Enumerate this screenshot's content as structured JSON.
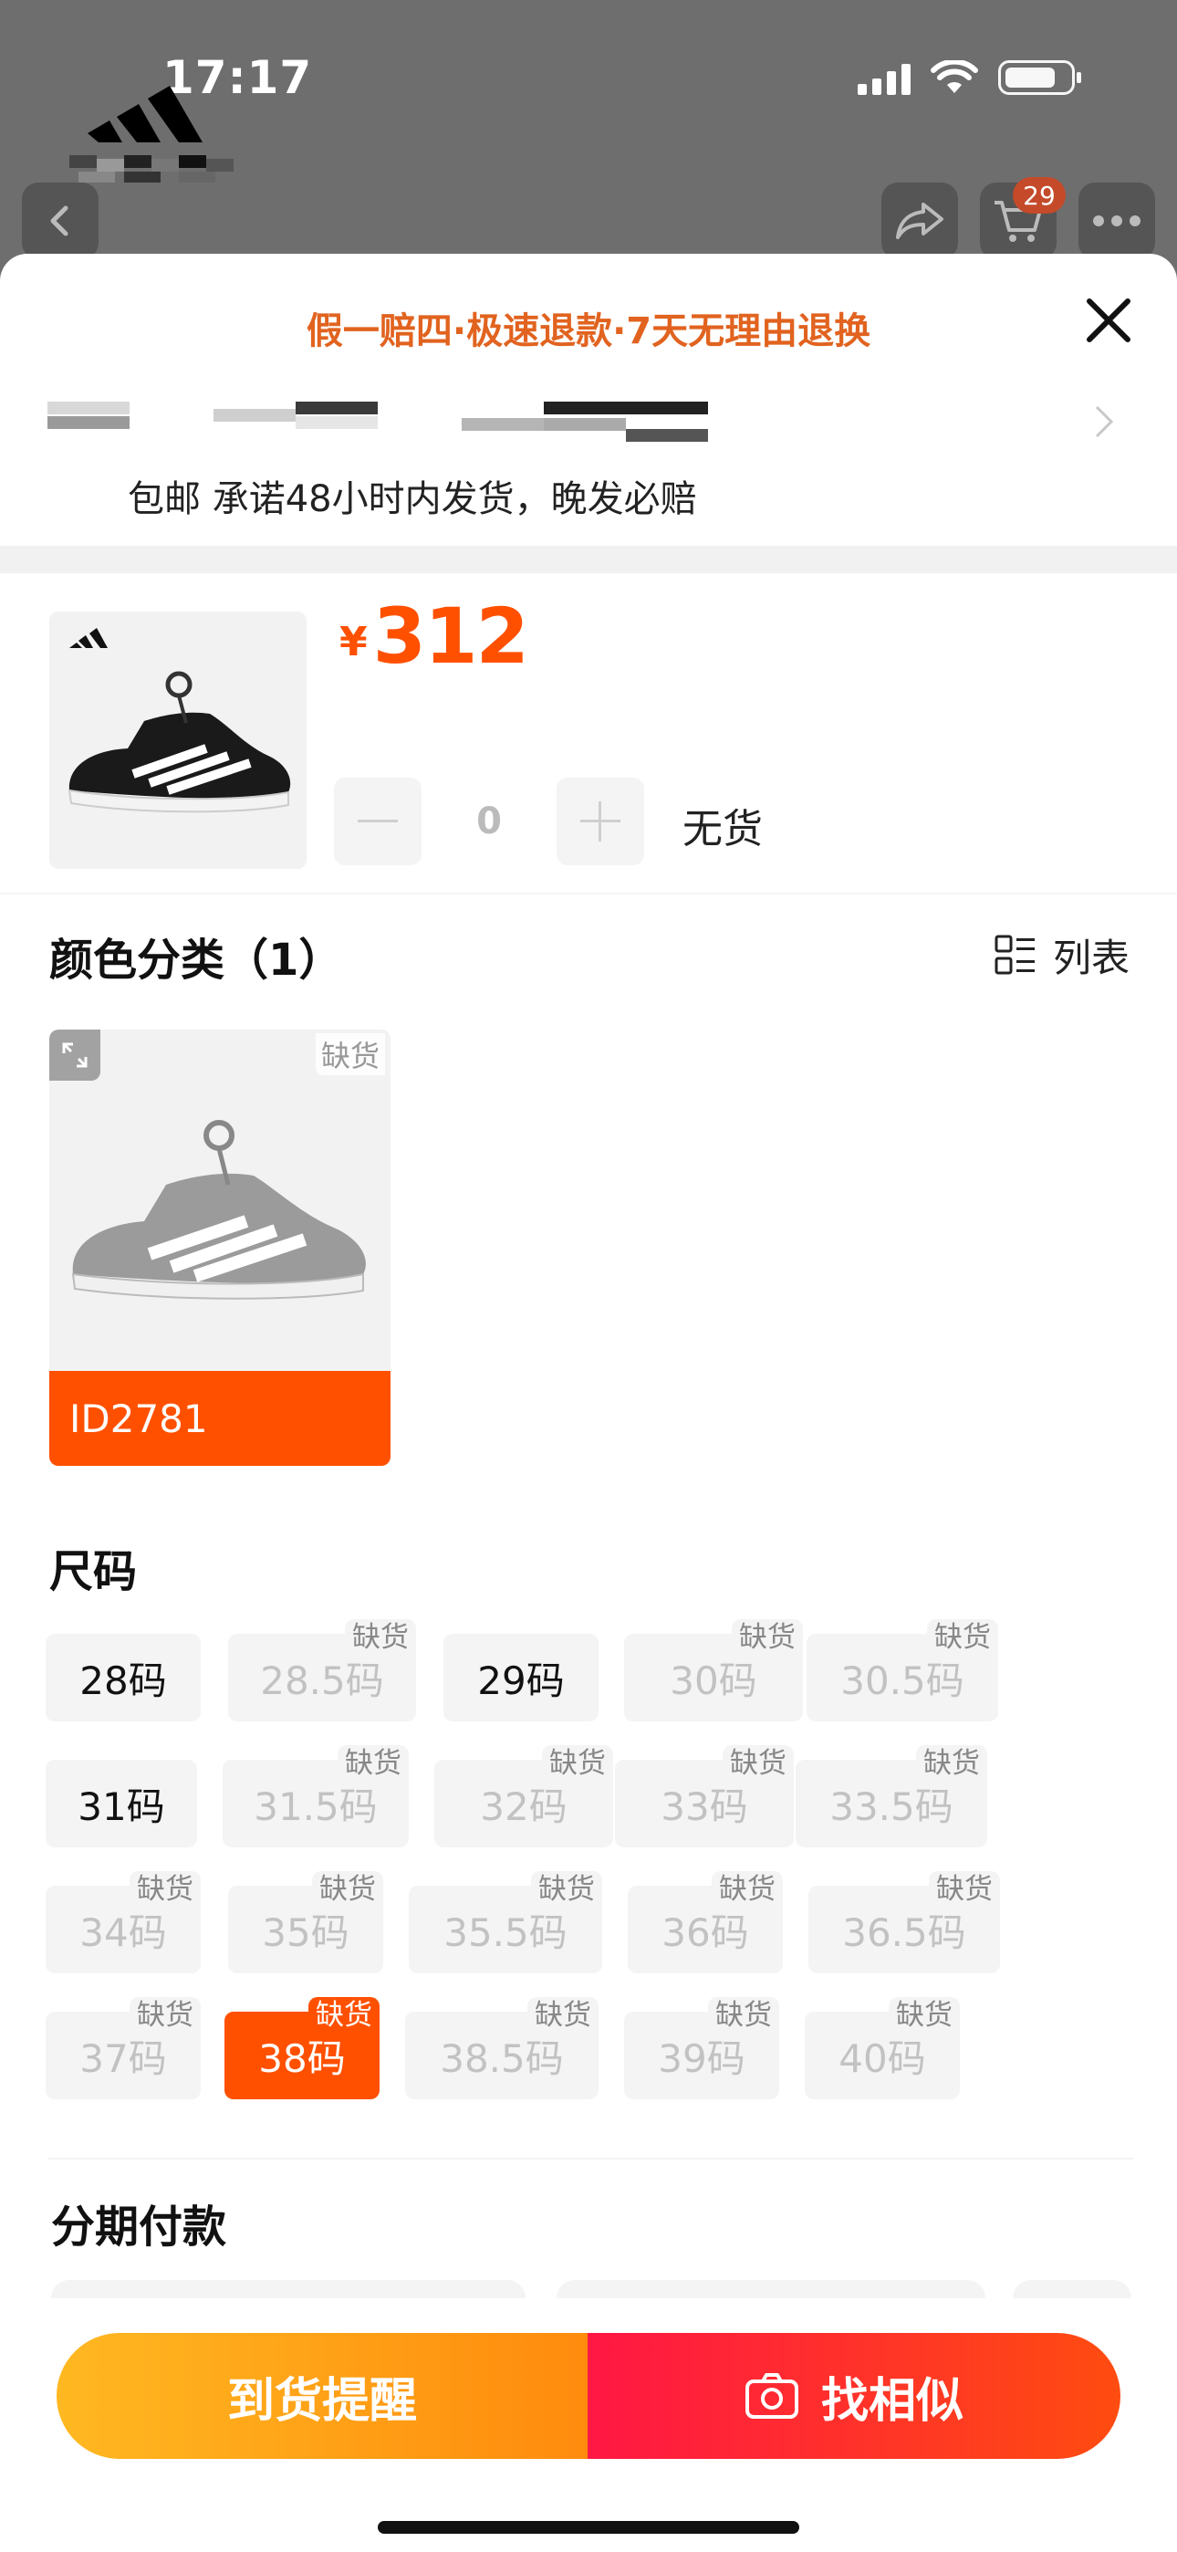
{
  "status_bar": {
    "time": "17:17"
  },
  "header": {
    "cart_badge": "29"
  },
  "sheet": {
    "guarantee_text": "假一赔四·极速退款·7天无理由退换",
    "shipping_text": "包邮 承诺48小时内发货，晚发必赔"
  },
  "product": {
    "currency": "¥",
    "price": "312",
    "quantity": "0",
    "stock_status": "无货"
  },
  "color_section": {
    "title": "颜色分类（1）",
    "list_toggle_label": "列表",
    "options": [
      {
        "label": "ID2781",
        "tag": "缺货",
        "selected": true
      }
    ]
  },
  "size_section": {
    "title": "尺码",
    "out_of_stock_tag": "缺货",
    "rows": [
      [
        {
          "label": "28码",
          "oos": false
        },
        {
          "label": "28.5码",
          "oos": true
        },
        {
          "label": "29码",
          "oos": false
        },
        {
          "label": "30码",
          "oos": true
        },
        {
          "label": "30.5码",
          "oos": true
        }
      ],
      [
        {
          "label": "31码",
          "oos": false
        },
        {
          "label": "31.5码",
          "oos": true
        },
        {
          "label": "32码",
          "oos": true
        },
        {
          "label": "33码",
          "oos": true
        },
        {
          "label": "33.5码",
          "oos": true
        }
      ],
      [
        {
          "label": "34码",
          "oos": true
        },
        {
          "label": "35码",
          "oos": true
        },
        {
          "label": "35.5码",
          "oos": true
        },
        {
          "label": "36码",
          "oos": true
        },
        {
          "label": "36.5码",
          "oos": true
        }
      ],
      [
        {
          "label": "37码",
          "oos": true
        },
        {
          "label": "38码",
          "oos": true,
          "selected": true
        },
        {
          "label": "38.5码",
          "oos": true
        },
        {
          "label": "39码",
          "oos": true
        },
        {
          "label": "40码",
          "oos": true
        }
      ]
    ]
  },
  "installment_section": {
    "title": "分期付款"
  },
  "actions": {
    "notify_label": "到货提醒",
    "similar_label": "找相似"
  },
  "colors": {
    "accent": "#ff5000",
    "guarantee": "#e1631f",
    "notify_gradient_start": "#ffb821",
    "similar_gradient_end": "#ff4c10"
  },
  "icons": [
    "back-icon",
    "share-icon",
    "cart-icon",
    "more-icon",
    "close-icon",
    "chevron-right-icon",
    "minus-icon",
    "plus-icon",
    "list-view-icon",
    "expand-icon",
    "camera-icon"
  ]
}
